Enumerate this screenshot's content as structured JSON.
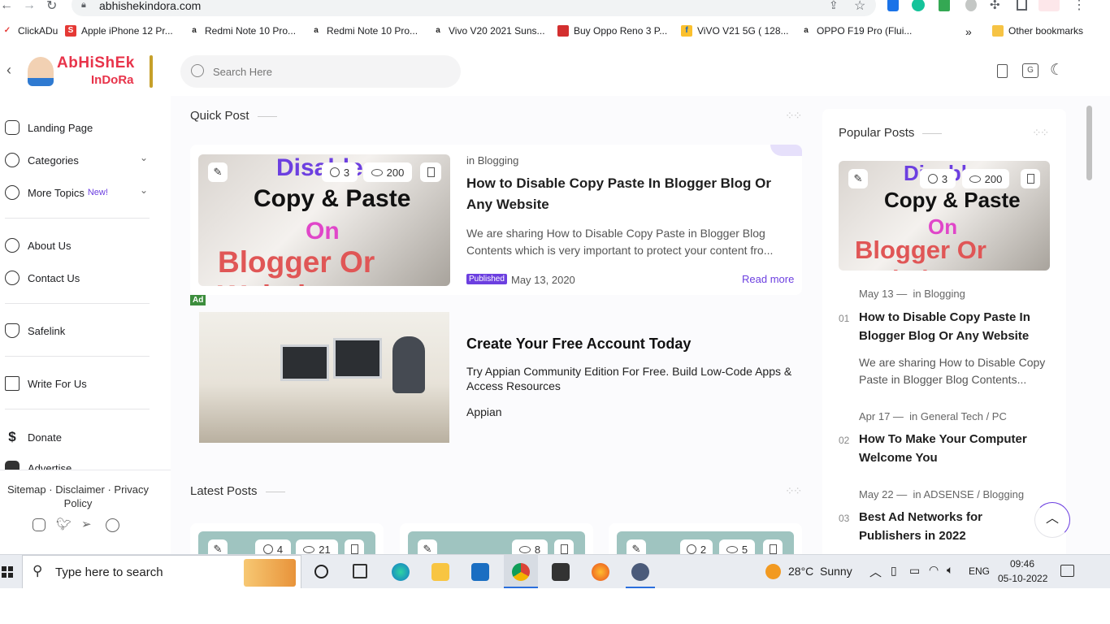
{
  "browser": {
    "url": "abhishekindora.com",
    "bookmarks": [
      {
        "label": "ClickADu",
        "color": "#e53935",
        "glyph": "✓"
      },
      {
        "label": "Apple iPhone 12 Pr...",
        "color": "#e53935",
        "glyph": "S"
      },
      {
        "label": "Redmi Note 10 Pro...",
        "color": "#222222",
        "glyph": "a"
      },
      {
        "label": "Redmi Note 10 Pro...",
        "color": "#222222",
        "glyph": "a"
      },
      {
        "label": "Vivo V20 2021 Suns...",
        "color": "#222222",
        "glyph": "a"
      },
      {
        "label": "Buy Oppo Reno 3 P...",
        "color": "#d32f2f",
        "glyph": "■"
      },
      {
        "label": "ViVO V21 5G ( 128...",
        "color": "#fbc02d",
        "glyph": "f"
      },
      {
        "label": "OPPO F19 Pro (Flui...",
        "color": "#222222",
        "glyph": "a"
      }
    ],
    "more_bookmarks": "»",
    "other_bookmarks": "Other bookmarks"
  },
  "header": {
    "logo_line1": "AbHiShEk",
    "logo_line2": "InDoRa",
    "search_placeholder": "Search Here"
  },
  "sidebar": {
    "items": [
      {
        "label": "Landing Page"
      },
      {
        "label": "Categories"
      },
      {
        "label": "More Topics",
        "tag": "New!"
      },
      {
        "label": "About Us"
      },
      {
        "label": "Contact Us"
      },
      {
        "label": "Safelink"
      },
      {
        "label": "Write For Us"
      },
      {
        "label": "Donate"
      },
      {
        "label": "Advertise"
      }
    ],
    "footer_links": "Sitemap · Disclaimer · Privacy Policy"
  },
  "quick_post": {
    "section_title": "Quick Post",
    "thumb_text": {
      "line1": "Disable",
      "line2": "Copy & Paste",
      "line3": "On",
      "line4": "Blogger Or Website"
    },
    "comments": "3",
    "views": "200",
    "category_prefix": "in",
    "category": "Blogging",
    "title": "How to Disable Copy Paste In Blogger Blog Or Any Website",
    "excerpt": "We are sharing  How to Disable Copy Paste in Blogger Blog Contents which is very  important to protect your content fro...",
    "badge": "Published",
    "date": "May 13, 2020",
    "read_more": "Read more"
  },
  "ad": {
    "tag": "Ad",
    "title": "Create Your Free Account Today",
    "body": "Try Appian Community Edition For Free. Build Low-Code Apps & Access Resources",
    "brand": "Appian"
  },
  "latest_posts": {
    "section_title": "Latest Posts",
    "cards": [
      {
        "comments": "4",
        "views": "21"
      },
      {
        "comments": "",
        "views": "8"
      },
      {
        "comments": "2",
        "views": "5"
      }
    ]
  },
  "popular_posts": {
    "section_title": "Popular Posts",
    "featured": {
      "comments": "3",
      "views": "200"
    },
    "items": [
      {
        "num": "01",
        "date": "May 13",
        "category": "Blogging",
        "title": "How to Disable Copy Paste In Blogger Blog Or Any Website",
        "excerpt": "We are sharing  How to Disable Copy Paste in Blogger Blog Contents..."
      },
      {
        "num": "02",
        "date": "Apr 17",
        "category": "General Tech / PC",
        "title": "How To Make Your Computer Welcome You",
        "excerpt": ""
      },
      {
        "num": "03",
        "date": "May 22",
        "category": "ADSENSE / Blogging",
        "title": "Best Ad Networks for Publishers in 2022",
        "excerpt": ""
      }
    ]
  },
  "taskbar": {
    "search_placeholder": "Type here to search",
    "weather_temp": "28°C",
    "weather_text": "Sunny",
    "lang": "ENG",
    "time": "09:46",
    "date": "05-10-2022"
  },
  "colors": {
    "accent": "#6c3fe0",
    "brand_red": "#e8334a"
  }
}
